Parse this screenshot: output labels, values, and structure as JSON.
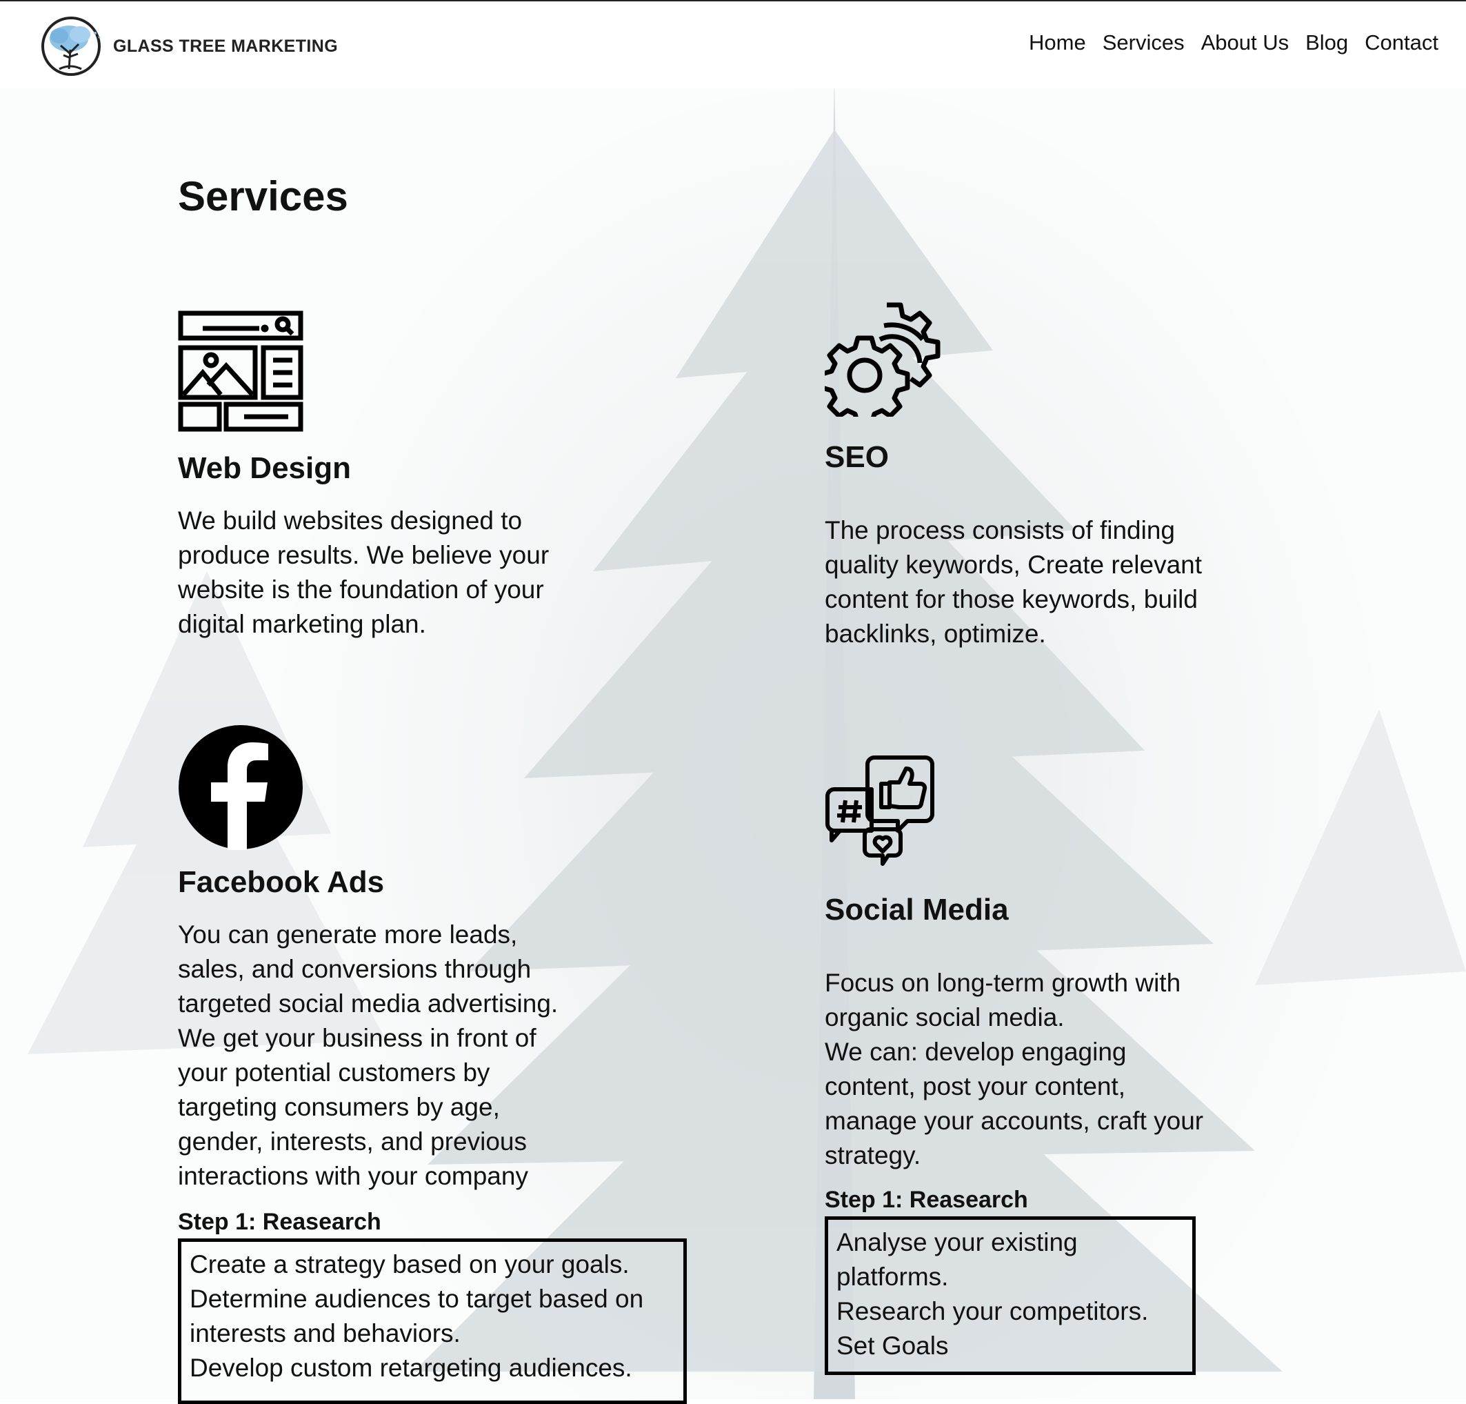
{
  "header": {
    "brand": "GLASS TREE MARKETING",
    "nav": [
      "Home",
      "Services",
      "About Us",
      "Blog",
      "Contact"
    ]
  },
  "page": {
    "title": "Services"
  },
  "services": [
    {
      "title": "Web Design",
      "icon": "web-design-icon",
      "description": "We build websites designed to produce results. We believe your website is the foundation of your digital marketing plan."
    },
    {
      "title": "SEO",
      "icon": "gears-icon",
      "description": "The process consists of finding quality keywords, Create relevant content for those keywords, build backlinks, optimize."
    },
    {
      "title": "Facebook Ads",
      "icon": "facebook-icon",
      "description_lines": [
        "You can generate more leads, sales, and conversions through targeted social media advertising.",
        "We get your business in front of your potential customers by targeting consumers by age, gender, interests, and previous interactions with your company"
      ],
      "step_label": "Step 1: Reasearch",
      "step_lines": [
        "Create a strategy based on your goals.",
        "Determine audiences to target based on interests and behaviors.",
        "Develop custom retargeting audiences."
      ]
    },
    {
      "title": "Social Media",
      "icon": "social-media-icon",
      "description_lines": [
        "Focus on long-term growth with organic social media.",
        "We can: develop engaging content, post your content, manage your accounts, craft your strategy."
      ],
      "step_label": "Step 1: Reasearch",
      "step_lines": [
        "Analyse your existing platforms.",
        "Research your competitors.",
        "Set Goals"
      ]
    }
  ]
}
